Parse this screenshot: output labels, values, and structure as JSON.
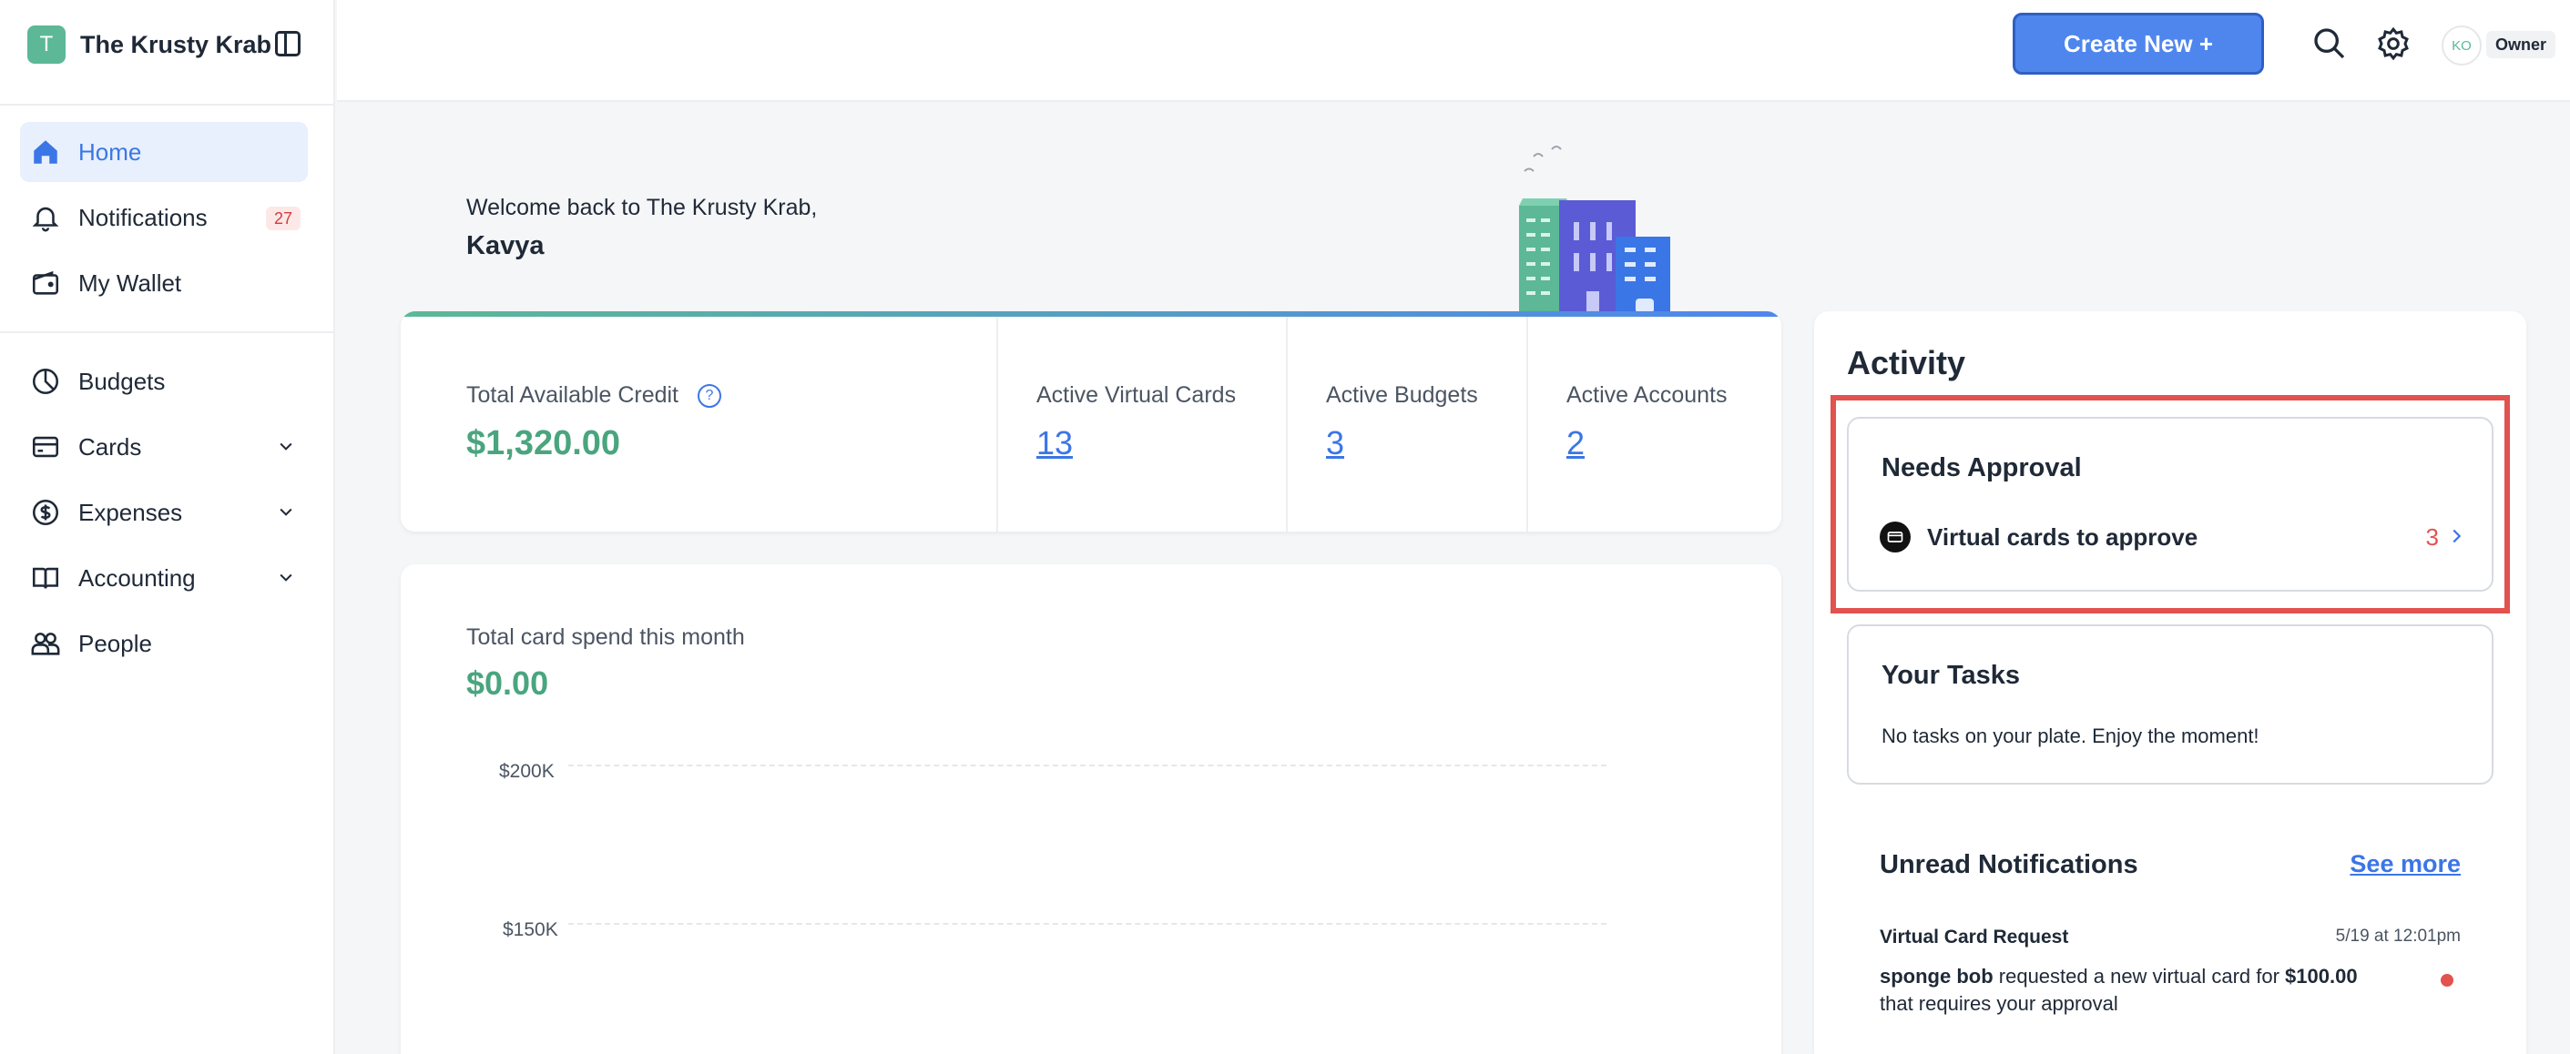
{
  "org": {
    "initial": "T",
    "name": "The Krusty Krab"
  },
  "sidebar": {
    "items": [
      {
        "label": "Home",
        "icon": "home-icon"
      },
      {
        "label": "Notifications",
        "icon": "bell-icon",
        "badge": "27"
      },
      {
        "label": "My Wallet",
        "icon": "wallet-icon"
      },
      {
        "label": "Budgets",
        "icon": "pie-chart-icon"
      },
      {
        "label": "Cards",
        "icon": "credit-card-icon"
      },
      {
        "label": "Expenses",
        "icon": "dollar-circle-icon"
      },
      {
        "label": "Accounting",
        "icon": "book-icon"
      },
      {
        "label": "People",
        "icon": "people-icon"
      }
    ]
  },
  "topbar": {
    "create_label": "Create New +",
    "user_initials": "KO",
    "role": "Owner"
  },
  "welcome": {
    "line": "Welcome back to The Krusty Krab,",
    "name": "Kavya"
  },
  "stats": {
    "credit_label": "Total Available Credit",
    "credit_value": "$1,320.00",
    "cards_label": "Active Virtual Cards",
    "cards_value": "13",
    "budgets_label": "Active Budgets",
    "budgets_value": "3",
    "accounts_label": "Active Accounts",
    "accounts_value": "2"
  },
  "spend": {
    "label": "Total card spend this month",
    "value": "$0.00",
    "ticks": [
      "$200K",
      "$150K"
    ]
  },
  "activity": {
    "title": "Activity",
    "approval": {
      "title": "Needs Approval",
      "row_label": "Virtual cards to approve",
      "row_count": "3"
    },
    "tasks": {
      "title": "Your Tasks",
      "empty": "No tasks on your plate. Enjoy the moment!"
    },
    "unread": {
      "title": "Unread Notifications",
      "see_more": "See more",
      "item": {
        "title": "Virtual Card Request",
        "time": "5/19 at 12:01pm",
        "actor": "sponge bob",
        "text1": " requested a new virtual card for ",
        "amount": "$100.00",
        "text2": " that requires your approval"
      }
    }
  },
  "colors": {
    "accent": "#4f86ee",
    "green": "#4aa57e",
    "alert": "#e2524f"
  }
}
